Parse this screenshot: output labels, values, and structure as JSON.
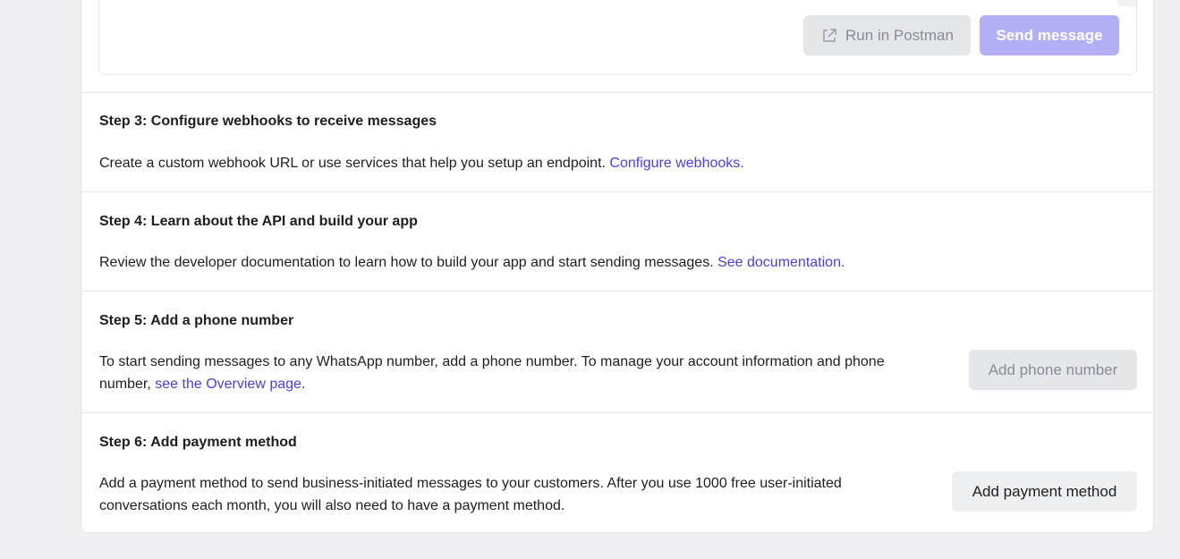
{
  "request_box": {
    "postman_label": "Run in Postman",
    "postman_icon": "external-link-icon",
    "send_label": "Send message"
  },
  "steps": [
    {
      "title": "Step 3: Configure webhooks to receive messages",
      "text": "Create a custom webhook URL or use services that help you setup an endpoint.",
      "link": "Configure webhooks."
    },
    {
      "title": "Step 4: Learn about the API and build your app",
      "text": "Review the developer documentation to learn how to build your app and start sending messages.",
      "link": "See documentation."
    },
    {
      "title": "Step 5: Add a phone number",
      "text": "To start sending messages to any WhatsApp number, add a phone number. To manage your account information and phone number,",
      "link": "see the Overview page",
      "suffix": ".",
      "button": "Add phone number"
    },
    {
      "title": "Step 6: Add payment method",
      "text": "Add a payment method to send business-initiated messages to your customers. After you use 1000 free user-initiated conversations each month, you will also need to have a payment method.",
      "button": "Add payment method"
    }
  ],
  "colors": {
    "link": "#4a3fd8",
    "send_button_disabled": "#b3b0f5",
    "secondary_button": "#e4e6e9"
  }
}
